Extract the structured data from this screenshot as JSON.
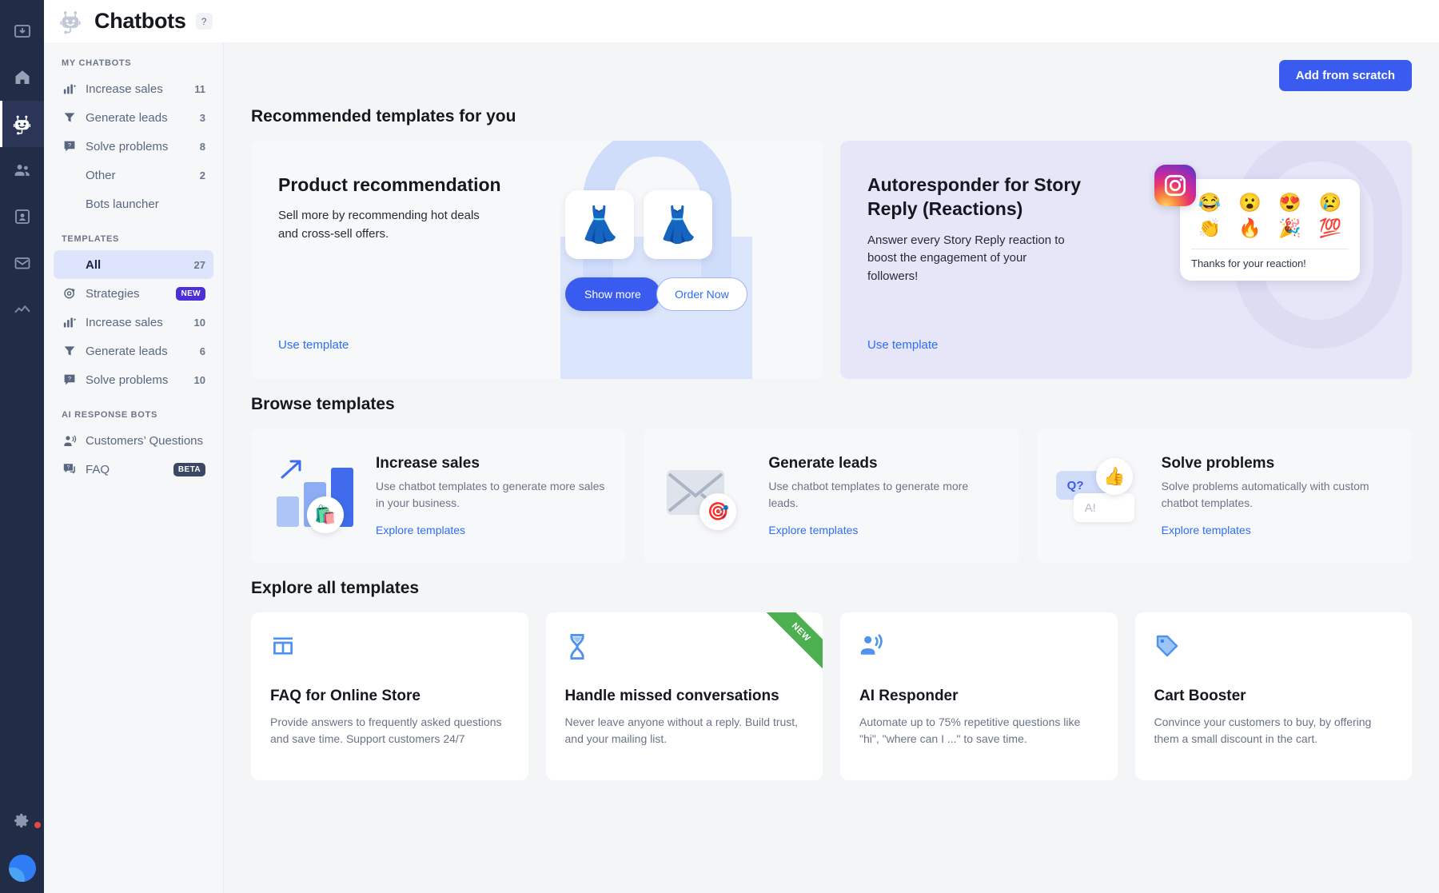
{
  "rail": {
    "items": [
      {
        "name": "inbox-icon",
        "label": "Inbox",
        "active": false
      },
      {
        "name": "home-icon",
        "label": "Home",
        "active": false
      },
      {
        "name": "chatbot-icon",
        "label": "Chatbots",
        "active": true
      },
      {
        "name": "contacts-icon",
        "label": "Contacts",
        "active": false
      },
      {
        "name": "card-icon",
        "label": "Cards",
        "active": false
      },
      {
        "name": "mail-icon",
        "label": "Email marketing",
        "active": false
      },
      {
        "name": "analytics-icon",
        "label": "Analytics",
        "active": false
      }
    ],
    "settings_label": "Settings"
  },
  "header": {
    "title": "Chatbots",
    "help_label": "?",
    "logo_name": "chatbot-logo"
  },
  "sidebar": {
    "groups": [
      {
        "heading": "MY CHATBOTS",
        "items": [
          {
            "label": "Increase sales",
            "count": "11",
            "icon": "increase-sales-icon",
            "active": false
          },
          {
            "label": "Generate leads",
            "count": "3",
            "icon": "funnel-icon",
            "active": false
          },
          {
            "label": "Solve problems",
            "count": "8",
            "icon": "question-bubble-icon",
            "active": false
          },
          {
            "label": "Other",
            "count": "2",
            "icon": "",
            "active": false
          },
          {
            "label": "Bots launcher",
            "count": "",
            "icon": "",
            "active": false
          }
        ]
      },
      {
        "heading": "TEMPLATES",
        "items": [
          {
            "label": "All",
            "count": "27",
            "icon": "",
            "active": true
          },
          {
            "label": "Strategies",
            "count": "",
            "badge": "NEW",
            "badge_type": "new",
            "icon": "target-icon",
            "active": false
          },
          {
            "label": "Increase sales",
            "count": "10",
            "icon": "increase-sales-icon",
            "active": false
          },
          {
            "label": "Generate leads",
            "count": "6",
            "icon": "funnel-icon",
            "active": false
          },
          {
            "label": "Solve problems",
            "count": "10",
            "icon": "question-bubble-icon",
            "active": false
          }
        ]
      },
      {
        "heading": "AI RESPONSE BOTS",
        "items": [
          {
            "label": "Customers’ Questions",
            "count": "",
            "icon": "speaking-person-icon",
            "active": false
          },
          {
            "label": "FAQ",
            "count": "",
            "badge": "BETA",
            "badge_type": "beta",
            "icon": "faq-bubble-icon",
            "active": false
          }
        ]
      }
    ]
  },
  "main": {
    "add_button": "Add from scratch",
    "recommended_heading": "Recommended templates for you",
    "browse_heading": "Browse templates",
    "explore_heading": "Explore all templates",
    "recommended": [
      {
        "title": "Product recommendation",
        "desc": "Sell more by recommending hot deals and cross-sell offers.",
        "link": "Use template",
        "art": {
          "tile_left": "👗",
          "tile_right": "👗",
          "btn_primary": "Show more",
          "btn_secondary": "Order Now"
        }
      },
      {
        "title": "Autoresponder for Story Reply (Reactions)",
        "desc": "Answer every Story Reply reaction to boost the engagement of your followers!",
        "link": "Use template",
        "art": {
          "platform_icon": "instagram-icon",
          "emojis": [
            "😂",
            "😮",
            "😍",
            "😢",
            "👏",
            "🔥",
            "🎉",
            "💯"
          ],
          "note": "Thanks for your reaction!"
        }
      }
    ],
    "browse": [
      {
        "title": "Increase sales",
        "desc": "Use chatbot templates to generate more sales in your business.",
        "link": "Explore templates",
        "art": "bar-chart-shopping-icon",
        "badge_emoji": "🛍️"
      },
      {
        "title": "Generate leads",
        "desc": "Use chatbot templates to generate more leads.",
        "link": "Explore templates",
        "art": "envelope-target-icon",
        "badge_emoji": "🎯"
      },
      {
        "title": "Solve problems",
        "desc": "Solve problems automatically with custom chatbot templates.",
        "link": "Explore templates",
        "art": "qa-bubbles-icon",
        "badge_emoji": "👍",
        "bubble_q": "Q?",
        "bubble_a": "A!"
      }
    ],
    "explore": [
      {
        "icon": "storefront-icon",
        "title": "FAQ for Online Store",
        "desc": "Provide answers to frequently asked questions and save time. Support customers 24/7",
        "ribbon": ""
      },
      {
        "icon": "hourglass-icon",
        "title": "Handle missed conversations",
        "desc": "Never leave anyone without a reply. Build trust, and your mailing list.",
        "ribbon": "NEW"
      },
      {
        "icon": "announce-icon",
        "title": "AI Responder",
        "desc": "Automate up to 75% repetitive questions like \"hi\", \"where can I ...\" to save time.",
        "ribbon": ""
      },
      {
        "icon": "price-tag-icon",
        "title": "Cart Booster",
        "desc": "Convince your customers to buy, by offering them a small discount in the cart.",
        "ribbon": ""
      }
    ]
  },
  "colors": {
    "accent": "#3a5bf0",
    "link": "#2f6df5",
    "rail_bg": "#212c47",
    "sidebar_active": "#dde4fb",
    "new_badge": "#4c2fd6",
    "beta_badge": "#3b4864",
    "ribbon_green": "#4caf50"
  }
}
